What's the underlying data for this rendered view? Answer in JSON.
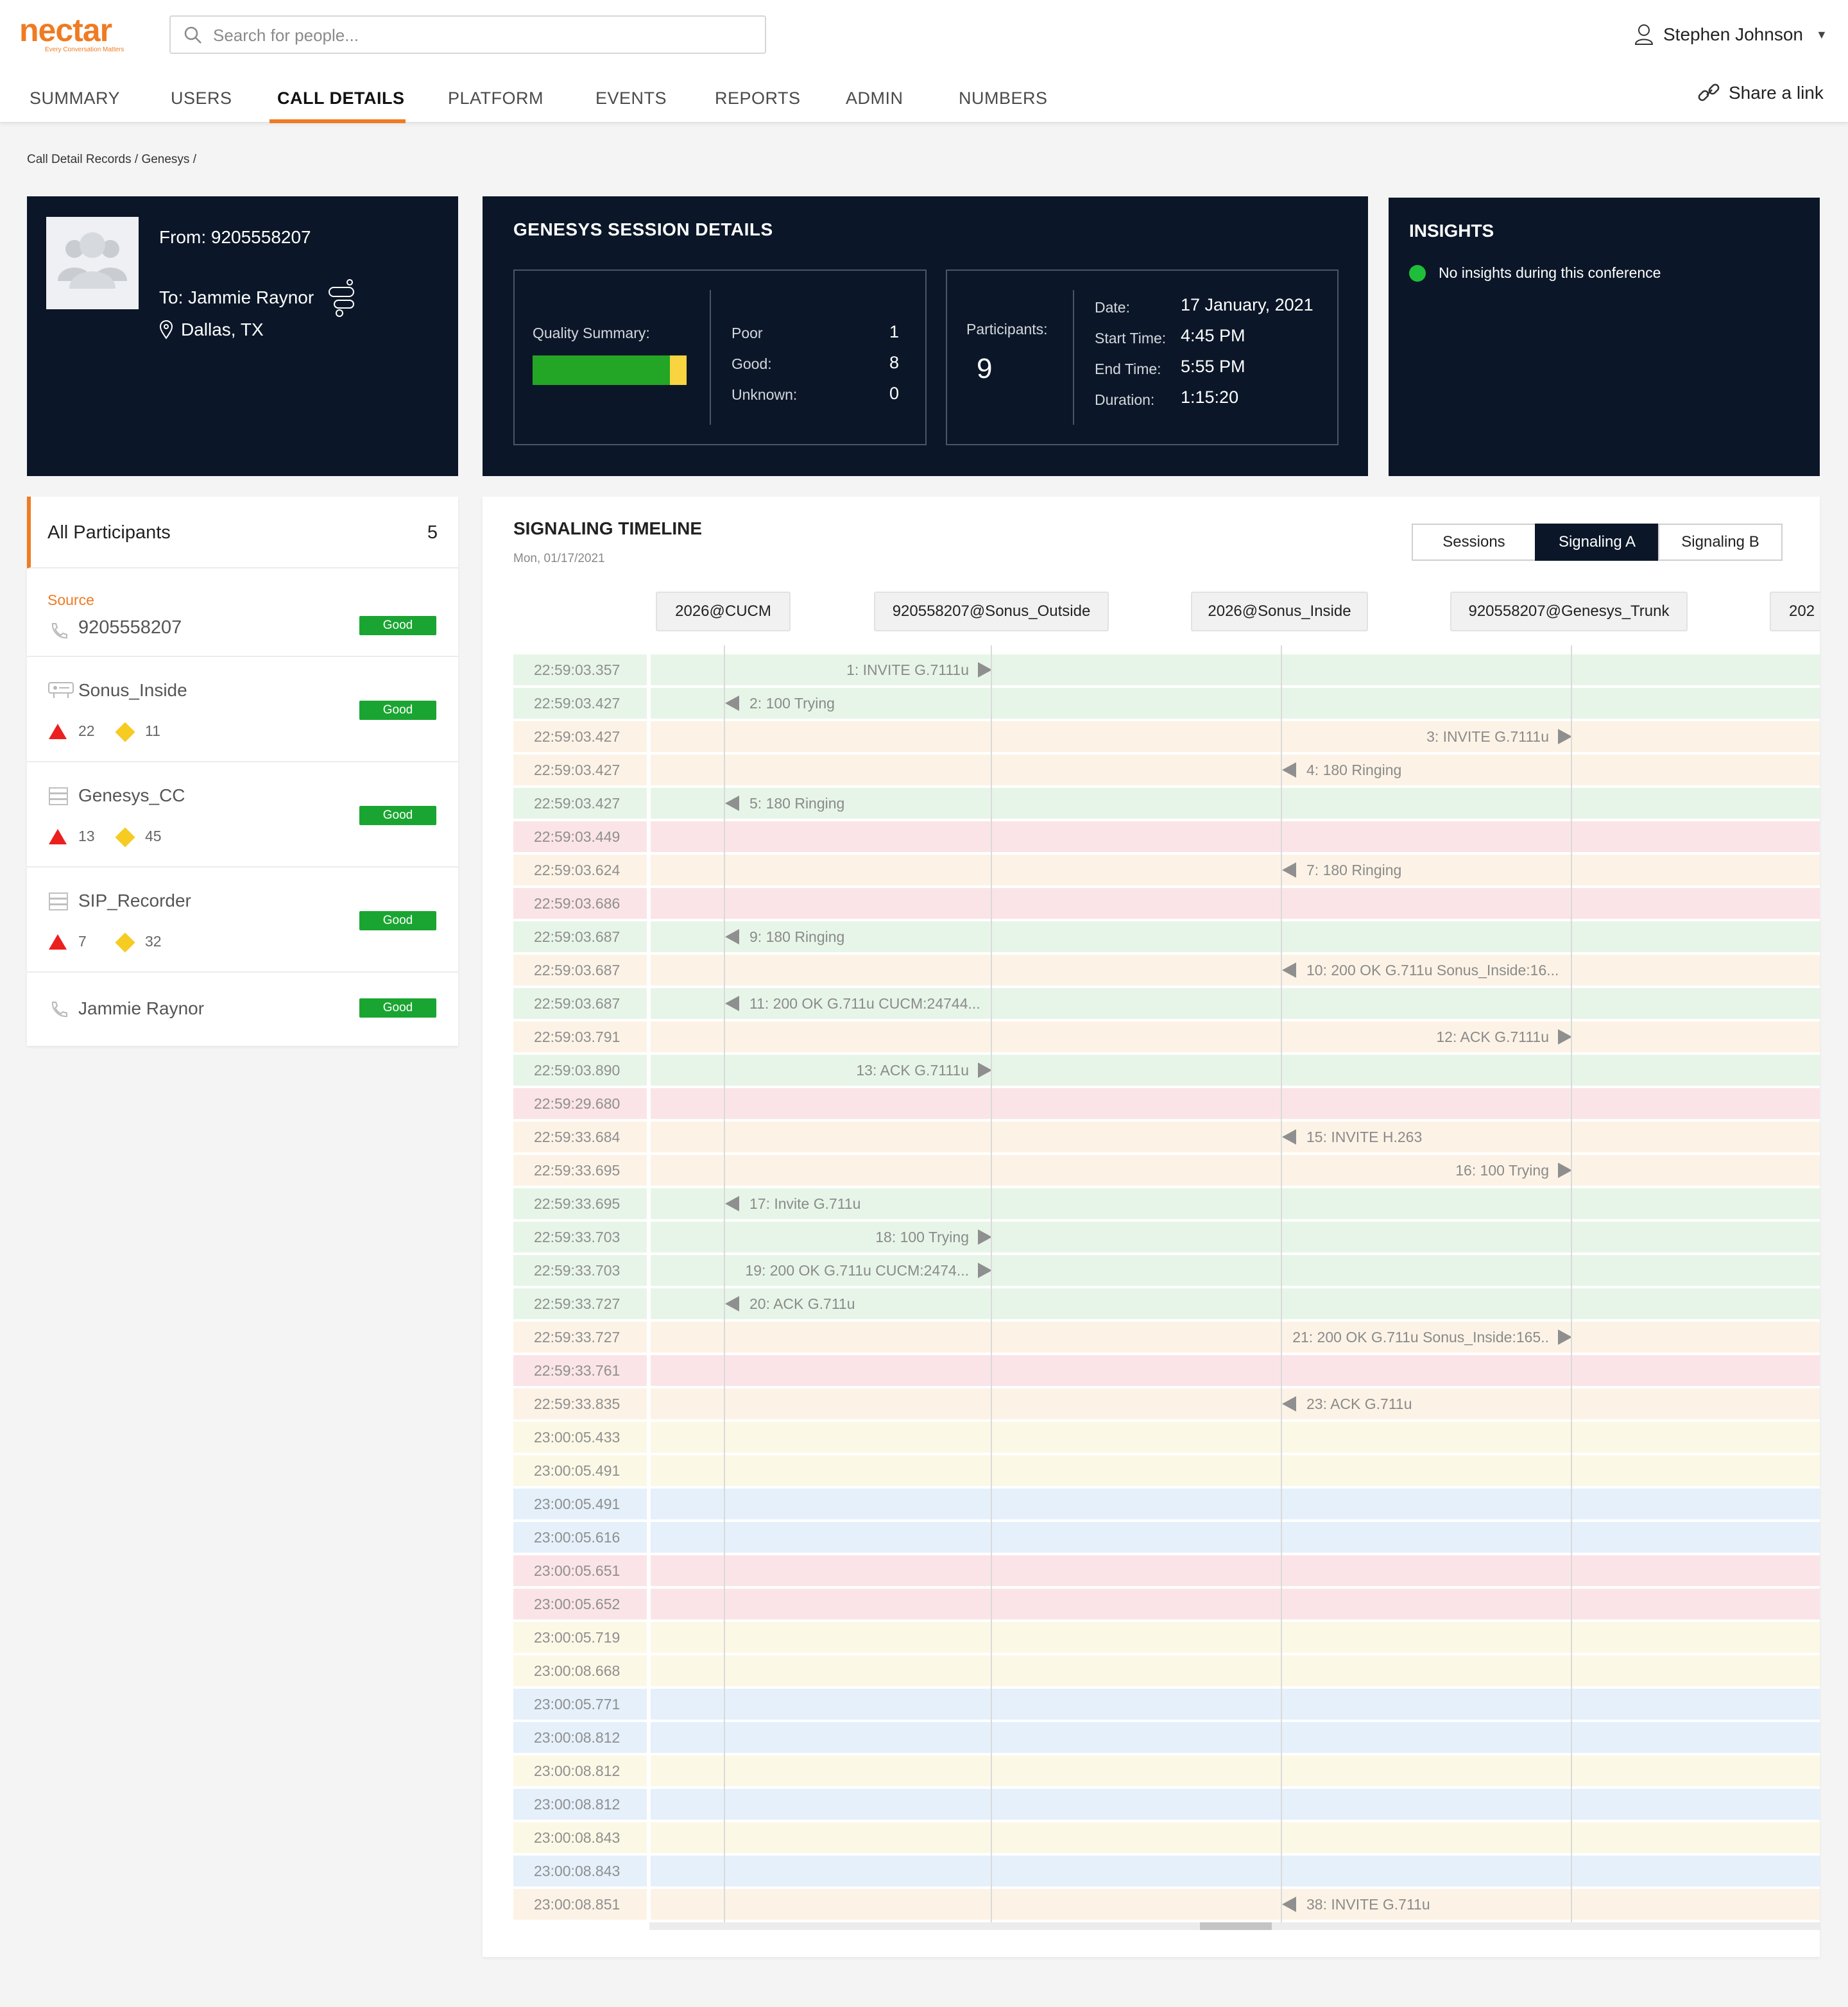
{
  "header": {
    "logo_text": "nectar",
    "logo_tagline": "Every Conversation Matters",
    "search_placeholder": "Search for people...",
    "user_name": "Stephen Johnson",
    "share_label": "Share a link",
    "brand_color": "#ef7b22"
  },
  "nav": {
    "tabs": [
      {
        "label": "SUMMARY"
      },
      {
        "label": "USERS"
      },
      {
        "label": "CALL DETAILS",
        "active": true
      },
      {
        "label": "PLATFORM"
      },
      {
        "label": "EVENTS"
      },
      {
        "label": "REPORTS"
      },
      {
        "label": "ADMIN"
      },
      {
        "label": "NUMBERS"
      }
    ]
  },
  "breadcrumb": "Call Detail Records / Genesys /",
  "call": {
    "from_label": "From:",
    "from": "9205558207",
    "to_label": "To:",
    "to": "Jammie Raynor",
    "location": "Dallas, TX"
  },
  "session": {
    "title": "GENESYS SESSION DETAILS",
    "quality_label": "Quality Summary:",
    "quality_good_fraction": 0.89,
    "poor_label": "Poor",
    "poor": "1",
    "good_label": "Good:",
    "good": "8",
    "unknown_label": "Unknown:",
    "unknown": "0",
    "participants_label": "Participants:",
    "participants": "9",
    "date_label": "Date:",
    "date": "17 January, 2021",
    "start_label": "Start Time:",
    "start": "4:45 PM",
    "end_label": "End Time:",
    "end": "5:55 PM",
    "duration_label": "Duration:",
    "duration": "1:15:20"
  },
  "insights": {
    "title": "INSIGHTS",
    "message": "No insights during this conference"
  },
  "participants_panel": {
    "title": "All Participants",
    "count": "5",
    "source_label": "Source",
    "items": [
      {
        "name": "9205558207",
        "status": "Good",
        "icon": "phone-icon"
      },
      {
        "name": "Sonus_Inside",
        "status": "Good",
        "icon": "router-icon",
        "errors": "22",
        "warnings": "11"
      },
      {
        "name": "Genesys_CC",
        "status": "Good",
        "icon": "server-icon",
        "errors": "13",
        "warnings": "45"
      },
      {
        "name": "SIP_Recorder",
        "status": "Good",
        "icon": "server-icon",
        "errors": "7",
        "warnings": "32"
      },
      {
        "name": "Jammie Raynor",
        "status": "Good",
        "icon": "phone-icon"
      }
    ]
  },
  "timeline": {
    "title": "SIGNALING TIMELINE",
    "date": "Mon, 01/17/2021",
    "buttons": [
      {
        "label": "Sessions"
      },
      {
        "label": "Signaling A",
        "active": true
      },
      {
        "label": "Signaling B"
      }
    ],
    "endpoints": [
      "2026@CUCM",
      "920558207@Sonus_Outside",
      "2026@Sonus_Inside",
      "920558207@Genesys_Trunk",
      "202"
    ],
    "rows": [
      {
        "ts": "22:59:03.357",
        "color": "green",
        "msg": "1: INVITE G.7111u",
        "from": 0,
        "to": 1
      },
      {
        "ts": "22:59:03.427",
        "color": "green",
        "msg": "2: 100 Trying",
        "from": 1,
        "to": 0
      },
      {
        "ts": "22:59:03.427",
        "color": "peach",
        "msg": "3: INVITE G.7111u",
        "from": 2,
        "to": 3
      },
      {
        "ts": "22:59:03.427",
        "color": "peach",
        "msg": "4: 180 Ringing",
        "from": 3,
        "to": 2
      },
      {
        "ts": "22:59:03.427",
        "color": "green",
        "msg": "5: 180 Ringing",
        "from": 1,
        "to": 0
      },
      {
        "ts": "22:59:03.449",
        "color": "pink"
      },
      {
        "ts": "22:59:03.624",
        "color": "peach",
        "msg": "7: 180 Ringing",
        "from": 3,
        "to": 2
      },
      {
        "ts": "22:59:03.686",
        "color": "pink"
      },
      {
        "ts": "22:59:03.687",
        "color": "green",
        "msg": "9: 180 Ringing",
        "from": 1,
        "to": 0
      },
      {
        "ts": "22:59:03.687",
        "color": "peach",
        "msg": "10: 200 OK G.711u Sonus_Inside:16...",
        "from": 3,
        "to": 2
      },
      {
        "ts": "22:59:03.687",
        "color": "green",
        "msg": "11: 200 OK G.711u CUCM:24744...",
        "from": 1,
        "to": 0
      },
      {
        "ts": "22:59:03.791",
        "color": "peach",
        "msg": "12: ACK G.7111u",
        "from": 2,
        "to": 3
      },
      {
        "ts": "22:59:03.890",
        "color": "green",
        "msg": "13: ACK G.7111u",
        "from": 0,
        "to": 1
      },
      {
        "ts": "22:59:29.680",
        "color": "pink"
      },
      {
        "ts": "22:59:33.684",
        "color": "peach",
        "msg": "15: INVITE H.263",
        "from": 3,
        "to": 2
      },
      {
        "ts": "22:59:33.695",
        "color": "peach",
        "msg": "16: 100 Trying",
        "from": 2,
        "to": 3
      },
      {
        "ts": "22:59:33.695",
        "color": "green",
        "msg": "17: Invite G.711u",
        "from": 1,
        "to": 0
      },
      {
        "ts": "22:59:33.703",
        "color": "green",
        "msg": "18:  100 Trying",
        "from": 0,
        "to": 1
      },
      {
        "ts": "22:59:33.703",
        "color": "green",
        "msg": "19:  200 OK G.711u CUCM:2474...",
        "from": 0,
        "to": 1
      },
      {
        "ts": "22:59:33.727",
        "color": "green",
        "msg": "20: ACK G.711u",
        "from": 1,
        "to": 0
      },
      {
        "ts": "22:59:33.727",
        "color": "peach",
        "msg": "21: 200 OK G.711u Sonus_Inside:165..",
        "from": 2,
        "to": 3
      },
      {
        "ts": "22:59:33.761",
        "color": "pink"
      },
      {
        "ts": "22:59:33.835",
        "color": "peach",
        "msg": "23: ACK G.711u",
        "from": 3,
        "to": 2
      },
      {
        "ts": "23:00:05.433",
        "color": "yellow"
      },
      {
        "ts": "23:00:05.491",
        "color": "yellow"
      },
      {
        "ts": "23:00:05.491",
        "color": "blue"
      },
      {
        "ts": "23:00:05.616",
        "color": "blue"
      },
      {
        "ts": "23:00:05.651",
        "color": "pink"
      },
      {
        "ts": "23:00:05.652",
        "color": "pink"
      },
      {
        "ts": "23:00:05.719",
        "color": "yellow"
      },
      {
        "ts": "23:00:08.668",
        "color": "yellow"
      },
      {
        "ts": "23:00:05.771",
        "color": "blue"
      },
      {
        "ts": "23:00:08.812",
        "color": "blue"
      },
      {
        "ts": "23:00:08.812",
        "color": "yellow"
      },
      {
        "ts": "23:00:08.812",
        "color": "blue"
      },
      {
        "ts": "23:00:08.843",
        "color": "yellow"
      },
      {
        "ts": "23:00:08.843",
        "color": "blue"
      },
      {
        "ts": "23:00:08.851",
        "color": "peach",
        "msg": "38: INVITE G.711u",
        "from": 3,
        "to": 2
      }
    ]
  }
}
